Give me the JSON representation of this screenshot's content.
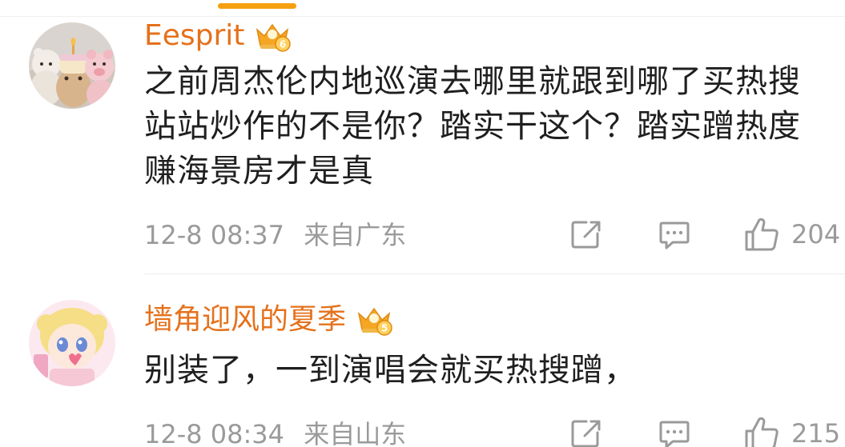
{
  "comments": [
    {
      "username": "Eesprit",
      "badge_icon": "crown-level-badge-icon",
      "badge_level": "6",
      "text_lines": [
        "之前周杰伦内地巡演去哪里就跟到哪了买热搜",
        "站站炒作的不是你？踏实干这个？踏实蹭热度",
        "赚海景房才是真"
      ],
      "time": "12-8 08:37",
      "location": "来自广东",
      "likes": "204"
    },
    {
      "username": "墙角迎风的夏季",
      "badge_icon": "crown-level-badge-icon",
      "badge_level": "5",
      "text_lines": [
        "别装了，一到演唱会就买热搜蹭，"
      ],
      "time": "12-8 08:34",
      "location": "来自山东",
      "likes": "215"
    }
  ],
  "icons": {
    "share": "share-icon",
    "comment": "comment-icon",
    "like": "thumbs-up-icon"
  },
  "colors": {
    "username": "#e5711b",
    "accent": "#f5a011",
    "text": "#1f1f1f",
    "meta": "#9a9a9a"
  }
}
